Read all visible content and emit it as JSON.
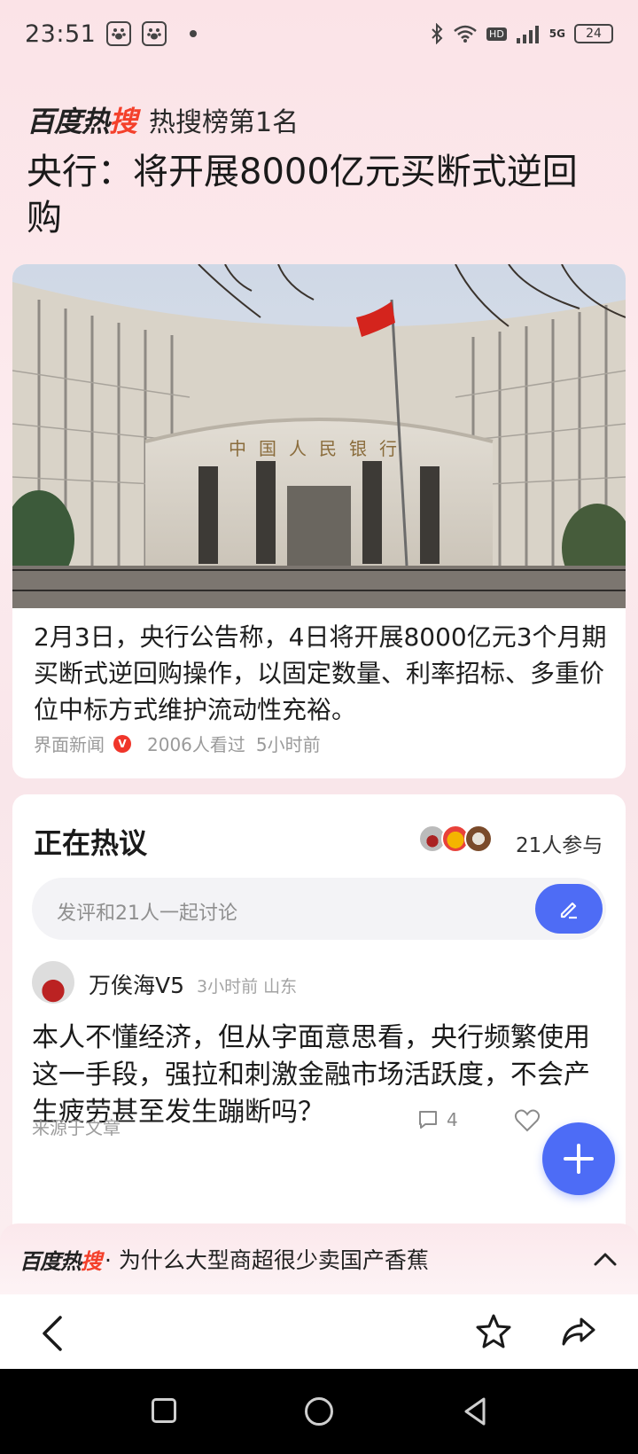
{
  "status_bar": {
    "time": "23:51",
    "hd": "HD",
    "network": "5G",
    "battery": "24"
  },
  "header": {
    "brand_main": "百度热",
    "brand_accent": "搜",
    "rank_label": "热搜榜第1名",
    "headline": "央行：将开展8000亿元买断式逆回购"
  },
  "article": {
    "summary": "2月3日，央行公告称，4日将开展8000亿元3个月期买断式逆回购操作，以固定数量、利率招标、多重价位中标方式维护流动性充裕。",
    "source": "界面新闻",
    "verified_mark": "V",
    "views": "2006人看过",
    "time": "5小时前",
    "building_sign": "中国人民银行"
  },
  "discussion": {
    "title": "正在热议",
    "participants": "21人参与",
    "input_placeholder": "发评和21人一起讨论",
    "comment": {
      "user": "万俟海V5",
      "meta": "3小时前 山东",
      "body": "本人不懂经济，但从字面意思看，央行频繁使用这一手段，强拉和刺激金融市场活跃度，不会产生疲劳甚至发生蹦断吗？",
      "source": "来源于文章",
      "reply_count": "4"
    }
  },
  "hot_bar": {
    "logo_main": "百度热",
    "logo_accent": "搜",
    "text": "· 为什么大型商超很少卖国产香蕉"
  },
  "colors": {
    "accent_blue": "#4e6cf5",
    "brand_red": "#f4402b",
    "background_pink": "#fbe6ea"
  },
  "icons": [
    "paw-icon",
    "bluetooth-icon",
    "wifi-icon",
    "signal-icon",
    "battery-icon",
    "verified-icon",
    "edit-icon",
    "comment-icon",
    "heart-icon",
    "plus-icon",
    "chevron-up-icon",
    "back-icon",
    "star-icon",
    "share-icon"
  ]
}
